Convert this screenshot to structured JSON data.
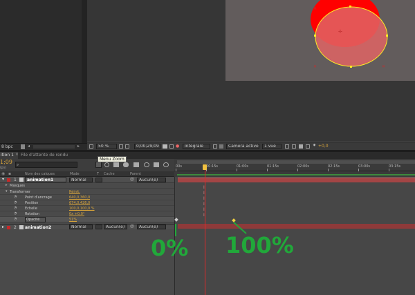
{
  "left_panel": {
    "bpc": "8 bpc"
  },
  "comp_toolbar": {
    "zoom": "50 %",
    "timecode": "0;00;29;09",
    "resolution": "Intégrale",
    "camera": "Caméra active",
    "view": "1 vue",
    "exposure": "+0,0"
  },
  "tabs": [
    "ition 1",
    "File d'attente de rendu"
  ],
  "timeline_header": {
    "time": "1;09",
    "fps": "ips)",
    "search_icon": "search-icon"
  },
  "tooltip": "Menu Zoom",
  "columns": {
    "layer_name": "Nom des calques",
    "mode": "Mode",
    "trkmat": "T",
    "cache": "Cache",
    "parent": "Parent"
  },
  "ruler": {
    "labels": [
      "00s",
      "00:15s",
      "01:00s",
      "01:15s",
      "02:00s",
      "02:15s",
      "03:00s",
      "03:15s"
    ]
  },
  "layers": [
    {
      "num": "1",
      "name": "animation1",
      "mode": "Normal",
      "parent": "Aucun(e)"
    },
    {
      "num": "2",
      "name": "animation2",
      "mode": "Normal",
      "cache": "Aucun(e)",
      "parent": "Aucun(e)"
    }
  ],
  "properties": [
    {
      "label": "Masques",
      "value": ""
    },
    {
      "label": "Transformer",
      "value": "Réinit."
    },
    {
      "label": "Point d'ancrage",
      "value": "640,0,360,0"
    },
    {
      "label": "Position",
      "value": "674,0,426,0"
    },
    {
      "label": "Echelle",
      "value": "100,0,100,0 %"
    },
    {
      "label": "Rotation",
      "value": "0x +0,0°"
    },
    {
      "label": "Opacité",
      "value": "51%"
    }
  ],
  "annotations": {
    "start": "0%",
    "end": "100%"
  },
  "colors": {
    "annot": "#21a83a",
    "layer_bar": "#9c3d3d",
    "playhead": "#e02b2b",
    "ellipse_stroke": "#ffee22"
  }
}
